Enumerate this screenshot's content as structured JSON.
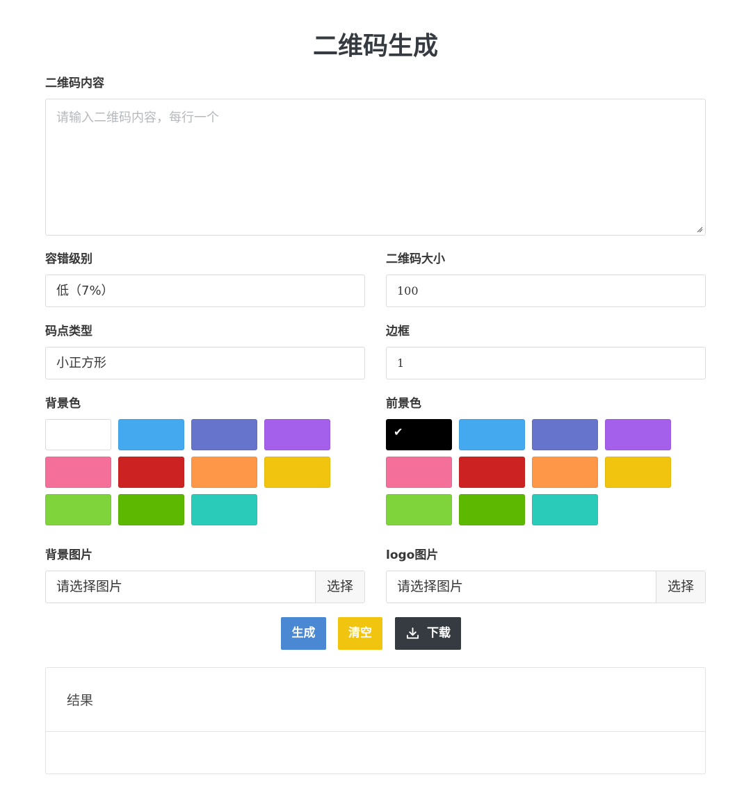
{
  "page": {
    "title": "二维码生成"
  },
  "content_input": {
    "label": "二维码内容",
    "placeholder": "请输入二维码内容，每行一个",
    "value": ""
  },
  "error_level": {
    "label": "容错级别",
    "value": "低（7%）"
  },
  "qr_size": {
    "label": "二维码大小",
    "value": "100"
  },
  "dot_type": {
    "label": "码点类型",
    "value": "小正方形"
  },
  "margin": {
    "label": "边框",
    "value": "1"
  },
  "background_color": {
    "label": "背景色",
    "selected": "#ffffff",
    "options": [
      "#ffffff",
      "#45a9ef",
      "#6675cb",
      "#a460ea",
      "#f46f9a",
      "#cc2222",
      "#fe9747",
      "#f1c40f",
      "#7ed43a",
      "#5db802",
      "#2acbb8"
    ]
  },
  "foreground_color": {
    "label": "前景色",
    "selected": "#000000",
    "selected_icon": "checkmark-icon",
    "options": [
      "#000000",
      "#45a9ef",
      "#6675cb",
      "#a460ea",
      "#f46f9a",
      "#cc2222",
      "#fe9747",
      "#f1c40f",
      "#7ed43a",
      "#5db802",
      "#2acbb8"
    ]
  },
  "background_image": {
    "label": "背景图片",
    "placeholder": "请选择图片",
    "button": "选择"
  },
  "logo_image": {
    "label": "logo图片",
    "placeholder": "请选择图片",
    "button": "选择"
  },
  "actions": {
    "generate": "生成",
    "clear": "清空",
    "download": "下载",
    "download_icon": "download-icon",
    "colors": {
      "generate": "#4a88d4",
      "clear": "#f1c40f",
      "download": "#363b41"
    }
  },
  "result": {
    "title": "结果"
  }
}
